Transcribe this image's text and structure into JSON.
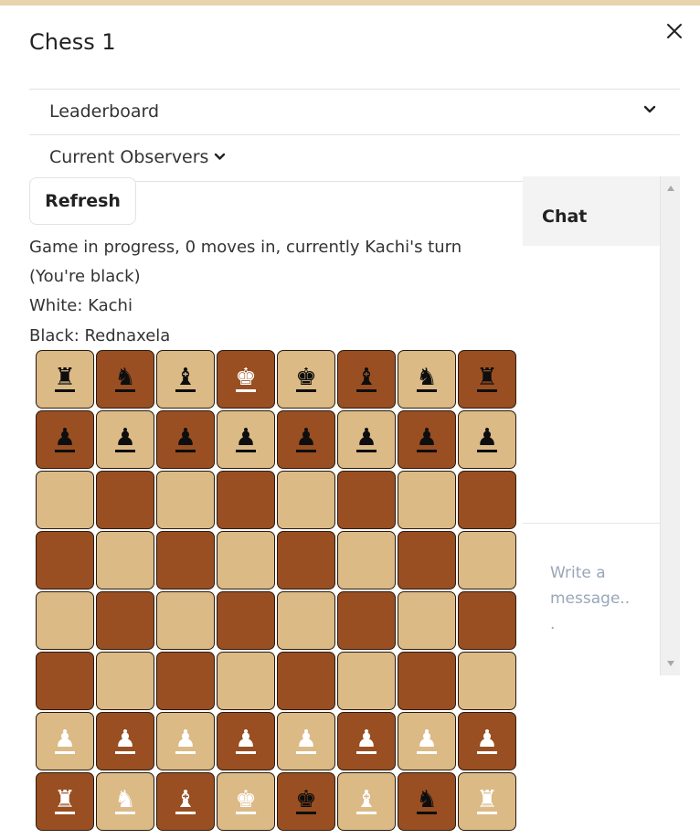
{
  "modal": {
    "title": "Chess 1",
    "close_icon": "close-icon"
  },
  "sections": {
    "leaderboard_label": "Leaderboard",
    "observers_label": "Current Observers"
  },
  "controls": {
    "refresh_label": "Refresh"
  },
  "game": {
    "status": "Game in progress, 0 moves in, currently Kachi's turn",
    "your_color": "(You're black)",
    "white_player": "White: Kachi",
    "black_player": "Black: Rednaxela"
  },
  "board": {
    "light_square_color": "#dbba86",
    "dark_square_color": "#994f22",
    "rows": [
      [
        "br",
        "bn",
        "bb",
        "wk",
        "bk",
        "bb",
        "bn",
        "br"
      ],
      [
        "bp",
        "bp",
        "bp",
        "bp",
        "bp",
        "bp",
        "bp",
        "bp"
      ],
      [
        "",
        "",
        "",
        "",
        "",
        "",
        "",
        ""
      ],
      [
        "",
        "",
        "",
        "",
        "",
        "",
        "",
        ""
      ],
      [
        "",
        "",
        "",
        "",
        "",
        "",
        "",
        ""
      ],
      [
        "",
        "",
        "",
        "",
        "",
        "",
        "",
        ""
      ],
      [
        "wp",
        "wp",
        "wp",
        "wp",
        "wp",
        "wp",
        "wp",
        "wp"
      ],
      [
        "wr",
        "wn",
        "wb",
        "wk",
        "bk",
        "wb",
        "bn",
        "wr"
      ]
    ]
  },
  "chat": {
    "title": "Chat",
    "input_placeholder": "Write a message..."
  }
}
